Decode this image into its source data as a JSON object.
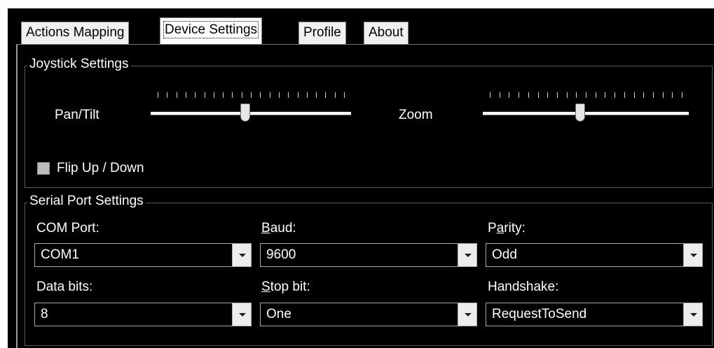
{
  "tabs": [
    {
      "label": "Actions Mapping",
      "active": false
    },
    {
      "label": "Device Settings",
      "active": true
    },
    {
      "label": "Profile",
      "active": false
    },
    {
      "label": "About",
      "active": false
    }
  ],
  "joystick": {
    "title": "Joystick Settings",
    "pan_tilt_label": "Pan/Tilt",
    "pan_tilt_value": 0.47,
    "zoom_label": "Zoom",
    "zoom_value": 0.47,
    "flip_label": "Flip Up / Down",
    "flip_checked": false
  },
  "serial": {
    "title": "Serial Port Settings",
    "com_port_label": "COM Port:",
    "com_port_value": "COM1",
    "baud_label": "Baud:",
    "baud_value": "9600",
    "parity_label": "Parity:",
    "parity_value": "Odd",
    "data_bits_label": "Data bits:",
    "data_bits_value": "8",
    "stop_bit_label": "Stop bit:",
    "stop_bit_value": "One",
    "handshake_label": "Handshake:",
    "handshake_value": "RequestToSend"
  },
  "colors": {
    "background": "#000000",
    "tab_active": "#ffffff",
    "tab_inactive": "#f0f0f0",
    "text": "#ffffff"
  }
}
